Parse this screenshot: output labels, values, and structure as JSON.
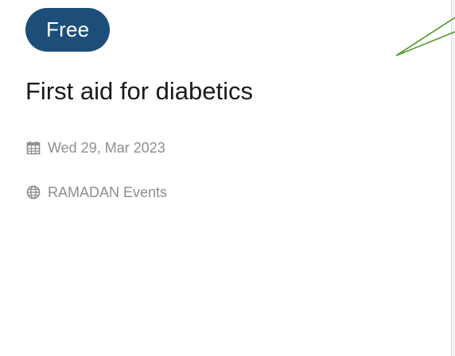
{
  "card": {
    "badge": "Free",
    "title": "First aid for diabetics",
    "date": "Wed 29, Mar 2023",
    "venue": "RAMADAN Events",
    "date_icon": "calendar-icon",
    "venue_icon": "globe-icon"
  },
  "colors": {
    "badge_bg": "#1d4e79",
    "badge_text": "#ffffff",
    "meta_text": "#8e8e8e",
    "pointer_line": "#4f9a2a"
  }
}
